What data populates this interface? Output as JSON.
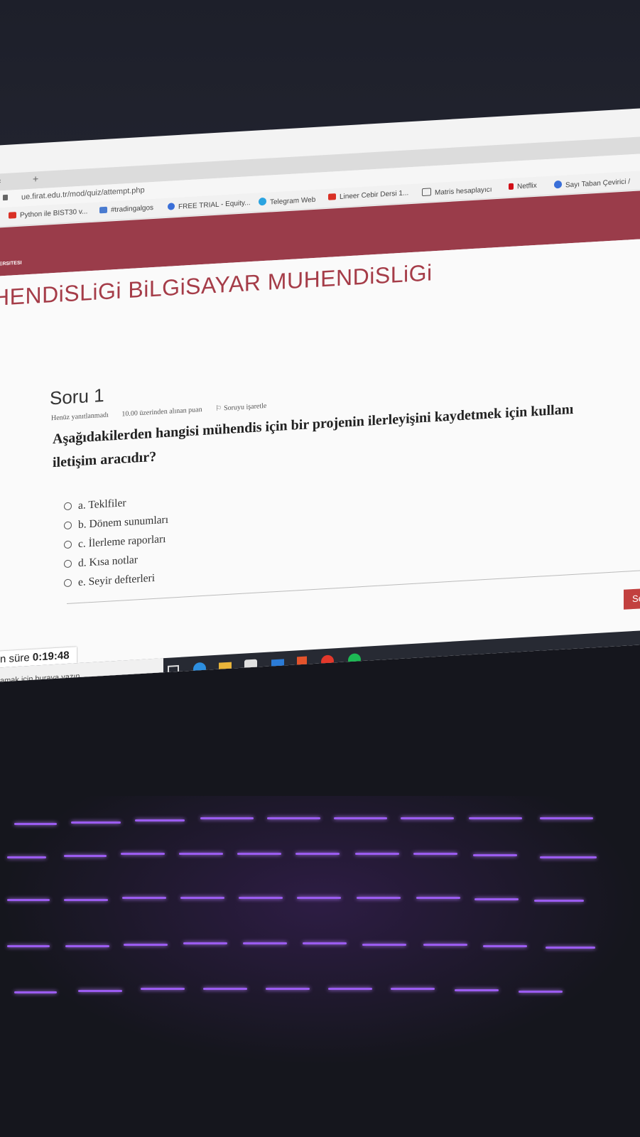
{
  "browser": {
    "tab_close": "×",
    "new_tab": "+",
    "url": "ue.firat.edu.tr/mod/quiz/attempt.php",
    "bookmarks": [
      {
        "label": "Python ile BIST30 v...",
        "color": "#d93025"
      },
      {
        "label": "#tradingalgos",
        "color": "#4a7bd0"
      },
      {
        "label": "FREE TRIAL - Equity...",
        "color": "#3a6fd8"
      },
      {
        "label": "Telegram Web",
        "color": "#2aa3e0"
      },
      {
        "label": "Lineer Cebir Dersi 1...",
        "color": "#d93025"
      },
      {
        "label": "Matris hesaplayıcı",
        "color": "#555555"
      },
      {
        "label": "Netflix",
        "color": "#d10e17"
      },
      {
        "label": "Sayı Taban Çevirici /",
        "color": "#3a6fd8"
      }
    ]
  },
  "site": {
    "logo_text": "T\nVERSITESI",
    "course_title": "HENDiSLiGi BiLGiSAYAR MUHENDiSLiGi"
  },
  "quiz": {
    "question_title": "Soru 1",
    "status": "Henüz yanıtlanmadı",
    "points": "10.00 üzerinden alınan puan",
    "flag": "Soruyu işaretle",
    "question_line1": "Aşağıdakilerden hangisi mühendis için bir projenin ilerleyişini kaydetmek için kullanı",
    "question_line2": "iletişim aracıdır?",
    "options": [
      "a. Teklfiler",
      "b. Dönem sunumları",
      "c. İlerleme raporları",
      "d. Kısa notlar",
      "e. Seyir defterleri"
    ],
    "timer_label": "n süre",
    "timer_value": "0:19:48",
    "next_label": "Se"
  },
  "taskbar": {
    "search_placeholder": "amak için buraya yazın"
  },
  "colors": {
    "header": "#9a3c4a",
    "title": "#a53c48",
    "key_glow": "#9b5cf0"
  }
}
